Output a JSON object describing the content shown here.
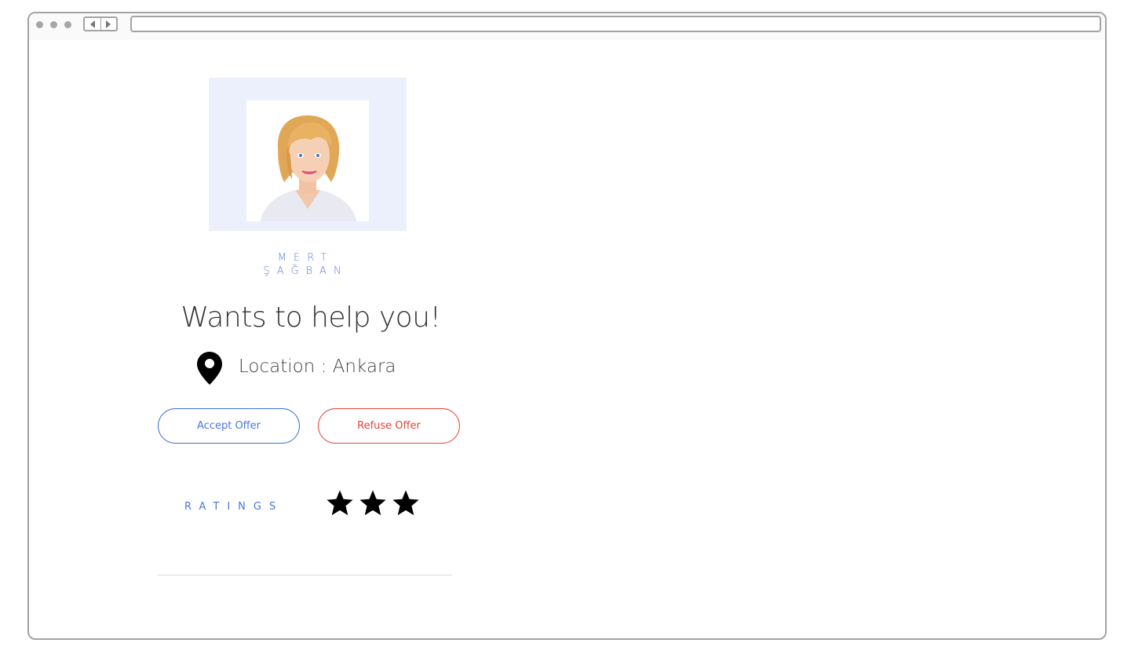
{
  "window": {
    "address": ""
  },
  "profile": {
    "first_name": "MERT",
    "last_name": "ŞAĞBAN",
    "headline": "Wants to help you!",
    "location_text": "Location : Ankara",
    "photo_background": "#ecf0fd"
  },
  "actions": {
    "accept_label": "Accept Offer",
    "refuse_label": "Refuse Offer",
    "accept_color": "#4a78dc",
    "refuse_color": "#e3443c"
  },
  "ratings": {
    "label": "RATINGS",
    "stars": 3
  },
  "icons": {
    "location": "map-pin-icon",
    "rating": "star-icon"
  }
}
